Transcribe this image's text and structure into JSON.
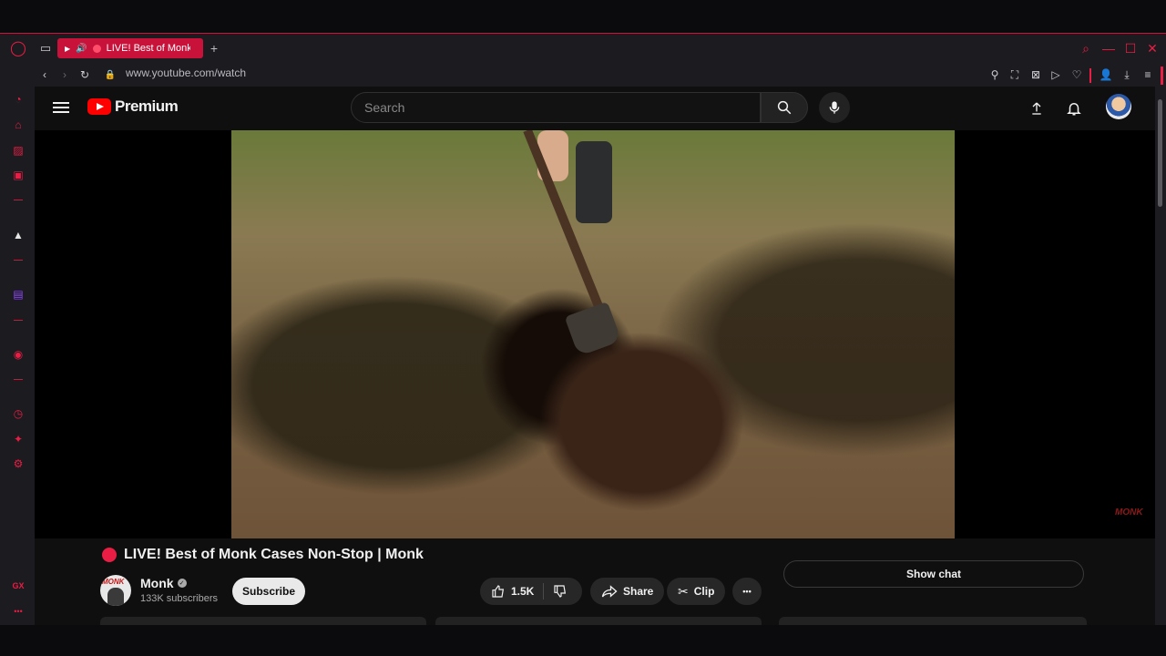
{
  "browser": {
    "tab_title": "LIVE! Best of Monk",
    "url": "www.youtube.com/watch",
    "accent": "#ea1d44"
  },
  "youtube": {
    "logo_text": "Premium",
    "search_placeholder": "Search",
    "video": {
      "watermark": "MONK",
      "title": "LIVE! Best of Monk Cases Non-Stop | Monk"
    },
    "channel": {
      "name": "Monk",
      "subscribers": "133K subscribers",
      "avatar_text": "MONK"
    },
    "actions": {
      "subscribe": "Subscribe",
      "likes": "1.5K",
      "share": "Share",
      "clip": "Clip",
      "more": "•••"
    },
    "show_chat": "Show chat"
  },
  "sidebar": {
    "gx_label": "GX",
    "more_label": "•••"
  }
}
